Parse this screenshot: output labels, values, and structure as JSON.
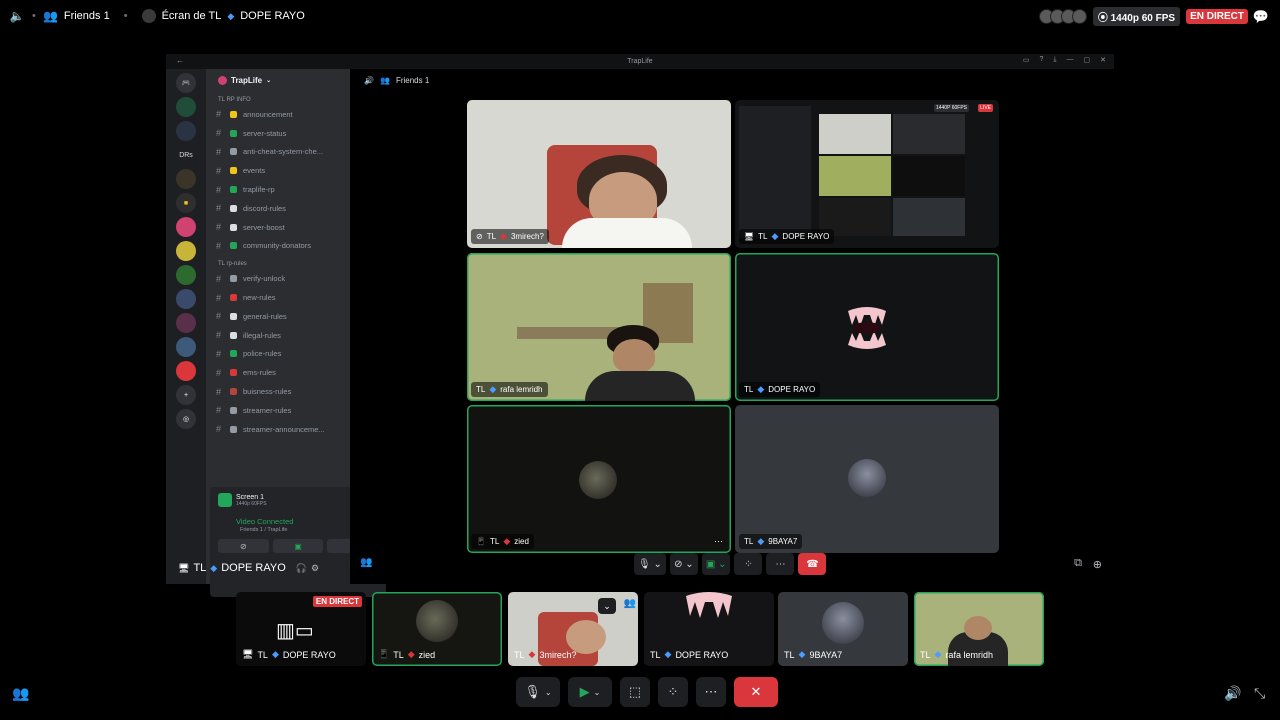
{
  "topbar": {
    "channel": "Friends 1",
    "screen_prefix": "Écran de TL",
    "screen_owner": "DOPE RAYO",
    "quality": "1440p 60 FPS",
    "live": "EN DIRECT"
  },
  "window": {
    "title": "TrapLife",
    "server_name": "TrapLife",
    "guild_dr_label": "DRs",
    "categories": [
      "TL RP INFO",
      "TL rp-rules"
    ],
    "info_channels": [
      "announcement",
      "server-status",
      "anti-cheat-system-che...",
      "events",
      "traplife-rp",
      "discord-rules",
      "server-boost",
      "community-donators"
    ],
    "rules_channels": [
      "verify-unlock",
      "new-rules",
      "general-rules",
      "illegal-rules",
      "police-rules",
      "ems-rules",
      "buisness-rules",
      "streamer-rules",
      "streamer-announceme..."
    ],
    "voice_panel": {
      "screen_title": "Screen 1",
      "screen_sub": "1440p 60FPS",
      "status": "Video Connected",
      "location": "Friends 1 / TrapLife"
    },
    "user": {
      "tag": "TL",
      "name": "DOPE RAYO"
    },
    "header_channel": "Friends 1",
    "tiles": [
      {
        "tag": "TL",
        "name": "3mirech?"
      },
      {
        "tag": "TL",
        "name": "DOPE RAYO",
        "badge": "1440P 60FPS",
        "live": "LIVE"
      },
      {
        "tag": "TL",
        "name": "rafa lemridh"
      },
      {
        "tag": "TL",
        "name": "DOPE RAYO"
      },
      {
        "tag": "TL",
        "name": "zied"
      },
      {
        "tag": "TL",
        "name": "9BAYA7"
      }
    ]
  },
  "strip": [
    {
      "tag": "TL",
      "name": "DOPE RAYO",
      "live": "EN DIRECT"
    },
    {
      "tag": "TL",
      "name": "zied"
    },
    {
      "tag": "TL",
      "name": "3mirech?"
    },
    {
      "tag": "TL",
      "name": "DOPE RAYO"
    },
    {
      "tag": "TL",
      "name": "9BAYA7"
    },
    {
      "tag": "TL",
      "name": "rafa lemridh"
    }
  ],
  "colors": {
    "green": "#23a55a",
    "red": "#da373c",
    "blurple": "#5865f2",
    "tag_blue": "#4b9cff"
  }
}
